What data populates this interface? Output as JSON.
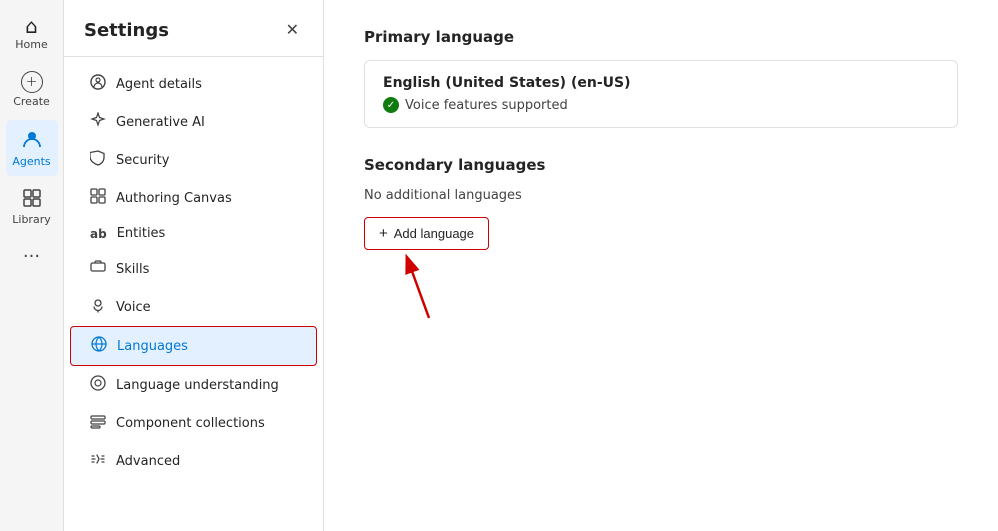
{
  "leftNav": {
    "items": [
      {
        "id": "home",
        "label": "Home",
        "icon": "⌂",
        "active": false
      },
      {
        "id": "create",
        "label": "Create",
        "icon": "+",
        "active": false
      },
      {
        "id": "agents",
        "label": "Agents",
        "icon": "◉",
        "active": true
      },
      {
        "id": "library",
        "label": "Library",
        "icon": "▦",
        "active": false
      }
    ],
    "more_icon": "···"
  },
  "settingsPanel": {
    "title": "Settings",
    "close_label": "✕",
    "menuItems": [
      {
        "id": "agent-details",
        "label": "Agent details",
        "icon": "⚙",
        "active": false
      },
      {
        "id": "generative-ai",
        "label": "Generative AI",
        "icon": "✦",
        "active": false
      },
      {
        "id": "security",
        "label": "Security",
        "icon": "🛡",
        "active": false
      },
      {
        "id": "authoring-canvas",
        "label": "Authoring Canvas",
        "icon": "⊞",
        "active": false
      },
      {
        "id": "entities",
        "label": "Entities",
        "icon": "ab",
        "active": false
      },
      {
        "id": "skills",
        "label": "Skills",
        "icon": "⊟",
        "active": false
      },
      {
        "id": "voice",
        "label": "Voice",
        "icon": "♟",
        "active": false
      },
      {
        "id": "languages",
        "label": "Languages",
        "icon": "⊕",
        "active": true
      },
      {
        "id": "language-understanding",
        "label": "Language understanding",
        "icon": "◎",
        "active": false
      },
      {
        "id": "component-collections",
        "label": "Component collections",
        "icon": "⊡",
        "active": false
      },
      {
        "id": "advanced",
        "label": "Advanced",
        "icon": "⇌",
        "active": false
      }
    ]
  },
  "mainContent": {
    "primaryLanguage": {
      "sectionTitle": "Primary language",
      "languageName": "English (United States) (en-US)",
      "voiceLabel": "Voice features supported"
    },
    "secondaryLanguages": {
      "sectionTitle": "Secondary languages",
      "noLangText": "No additional languages",
      "addButtonLabel": "Add language",
      "addButtonIcon": "+"
    }
  }
}
